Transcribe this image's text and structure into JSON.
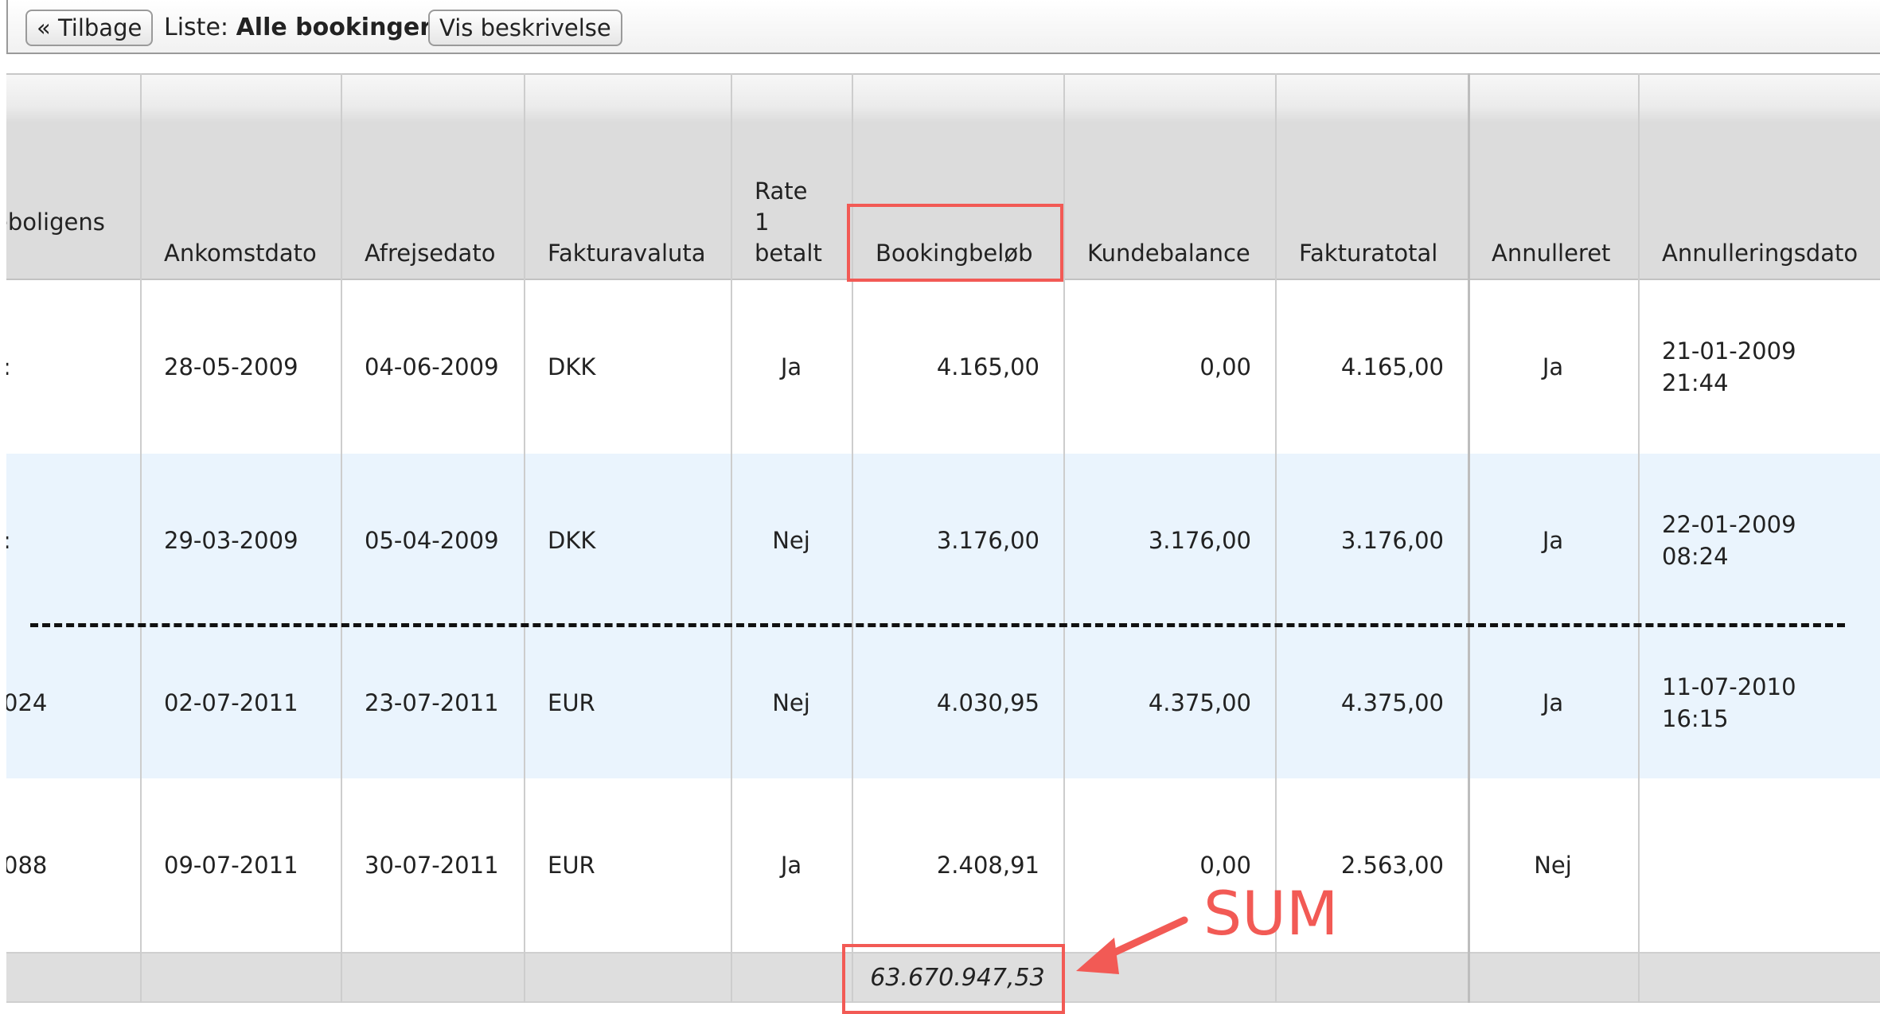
{
  "toolbar": {
    "back_label": "« Tilbage",
    "list_prefix": "Liste:",
    "list_name": "Alle bookinger",
    "description_label": "Vis beskrivelse"
  },
  "columns": [
    "eboligens\nn",
    "Ankomstdato",
    "Afrejsedato",
    "Fakturavaluta",
    "Rate\n1\nbetalt",
    "Bookingbeløb",
    "Kundebalance",
    "Fakturatotal",
    "Annulleret",
    "Annulleringsdato"
  ],
  "rows": [
    {
      "c0": ":",
      "arrival": "28-05-2009",
      "departure": "04-06-2009",
      "currency": "DKK",
      "rate_paid": "Ja",
      "booking_amount": "4.165,00",
      "balance": "0,00",
      "invoice_total": "4.165,00",
      "cancelled": "Ja",
      "cancel_date": "21-01-2009\n21:44"
    },
    {
      "c0": ":",
      "arrival": "29-03-2009",
      "departure": "05-04-2009",
      "currency": "DKK",
      "rate_paid": "Nej",
      "booking_amount": "3.176,00",
      "balance": "3.176,00",
      "invoice_total": "3.176,00",
      "cancelled": "Ja",
      "cancel_date": "22-01-2009\n08:24"
    },
    {
      "c0": "024",
      "arrival": "02-07-2011",
      "departure": "23-07-2011",
      "currency": "EUR",
      "rate_paid": "Nej",
      "booking_amount": "4.030,95",
      "balance": "4.375,00",
      "invoice_total": "4.375,00",
      "cancelled": "Ja",
      "cancel_date": "11-07-2010\n16:15"
    },
    {
      "c0": "088",
      "arrival": "09-07-2011",
      "departure": "30-07-2011",
      "currency": "EUR",
      "rate_paid": "Ja",
      "booking_amount": "2.408,91",
      "balance": "0,00",
      "invoice_total": "2.563,00",
      "cancelled": "Nej",
      "cancel_date": ""
    }
  ],
  "total": {
    "booking_amount": "63.670.947,53"
  },
  "annotation": {
    "sum_label": "SUM",
    "color": "#f25a55"
  }
}
